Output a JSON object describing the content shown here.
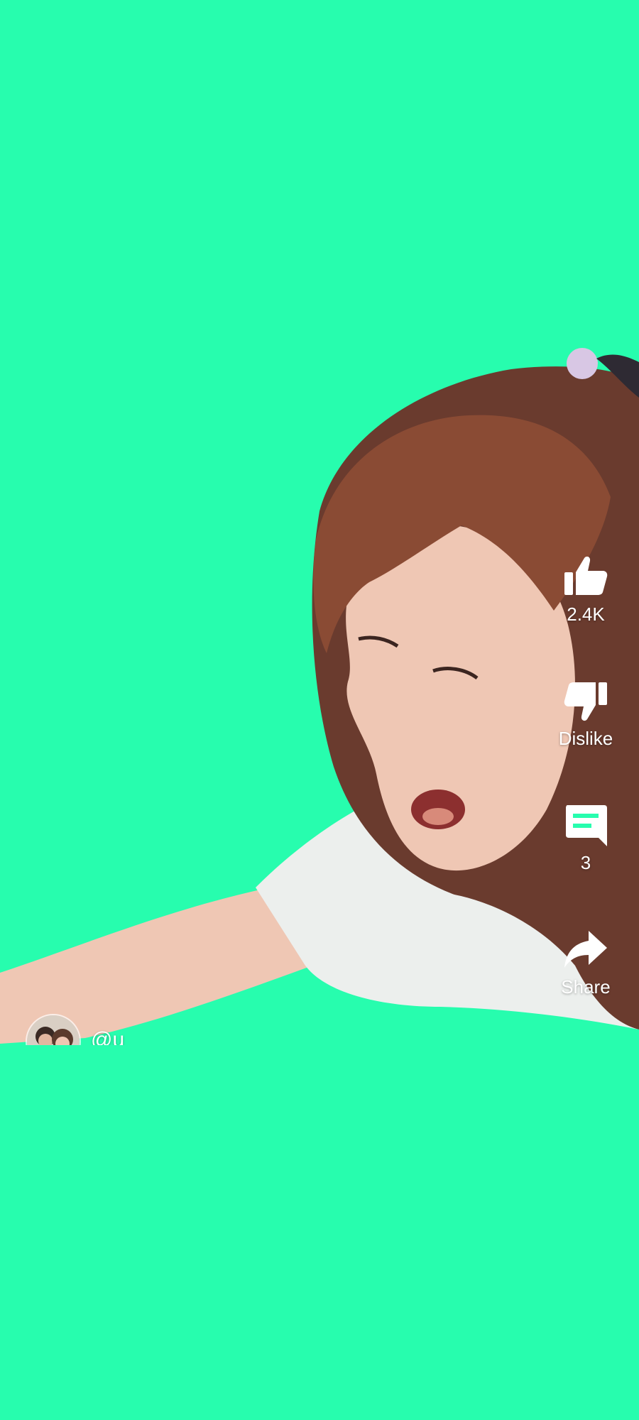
{
  "colors": {
    "background": "#27fdae",
    "label": "#ffffff",
    "skin": "#efc7b4",
    "hair": "#6a3b2e",
    "shirt": "#ecefed"
  },
  "actions": {
    "like": {
      "icon": "thumbs-up-icon",
      "label": "2.4K"
    },
    "dislike": {
      "icon": "thumbs-down-icon",
      "label": "Dislike"
    },
    "comments": {
      "icon": "comment-icon",
      "label": "3"
    },
    "share": {
      "icon": "share-arrow-icon",
      "label": "Share"
    }
  },
  "channel": {
    "handle": "@u"
  }
}
